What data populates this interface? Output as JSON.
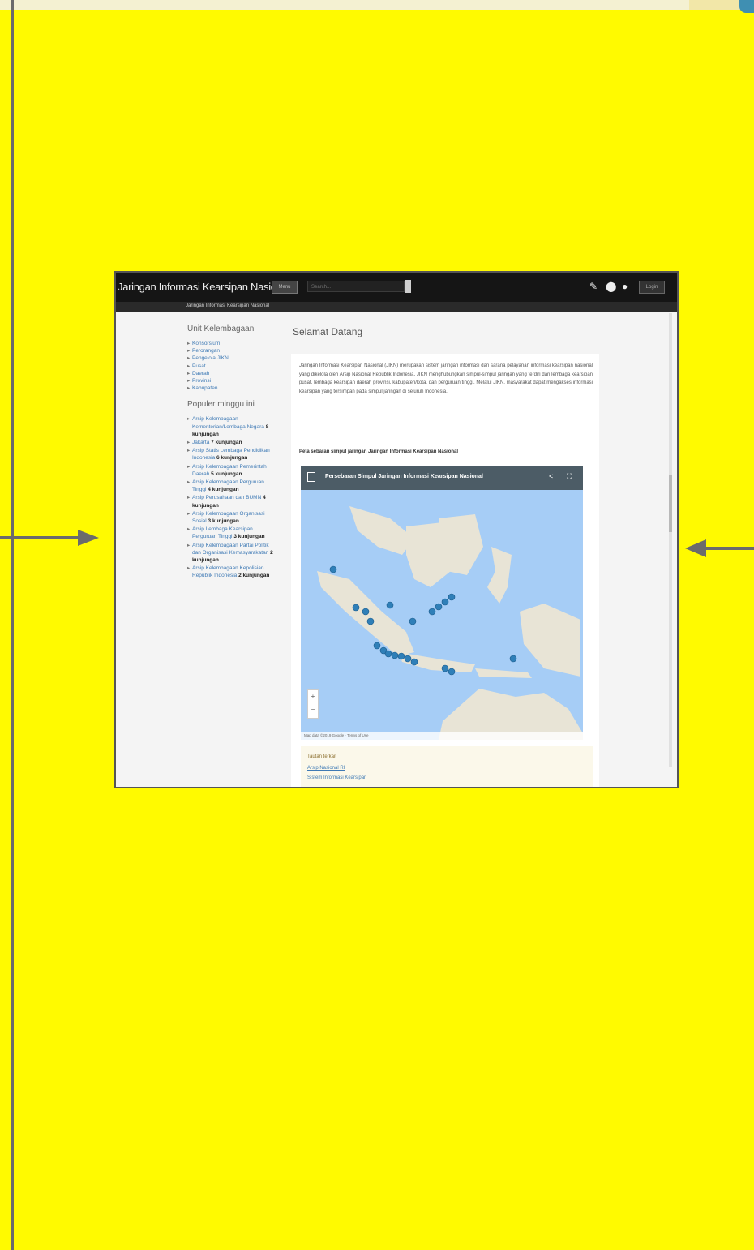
{
  "app": {
    "title": "Jaringan Informasi Kearsipan Nasional",
    "nav_button": "Menu",
    "search_placeholder": "Search...",
    "login_button": "Login",
    "breadcrumb": "Jaringan Informasi Kearsipan Nasional"
  },
  "sidebar": {
    "section1_title": "Unit Kelembagaan",
    "items": [
      "Konsorsium",
      "Perorangan",
      "Pengelola JIKN",
      "Pusat",
      "Daerah",
      "Provinsi",
      "Kabupaten"
    ],
    "section2_title": "Populer minggu ini",
    "popular": [
      {
        "text": "Arsip Kelembagaan Kementerian/Lembaga Negara",
        "count": "8 kunjungan"
      },
      {
        "text": "Jakarta",
        "count": "7 kunjungan"
      },
      {
        "text": "Arsip Statis Lembaga Pendidikan Indonesia",
        "count": "6 kunjungan"
      },
      {
        "text": "Arsip Kelembagaan Pemerintah Daerah",
        "count": "5 kunjungan"
      },
      {
        "text": "Arsip Kelembagaan Perguruan Tinggi",
        "count": "4 kunjungan"
      },
      {
        "text": "Arsip Perusahaan dan BUMN",
        "count": "4 kunjungan"
      },
      {
        "text": "Arsip Kelembagaan Organisasi Sosial",
        "count": "3 kunjungan"
      },
      {
        "text": "Arsip Lembaga Kearsipan Perguruan Tinggi",
        "count": "3 kunjungan"
      },
      {
        "text": "Arsip Kelembagaan Partai Politik dan Organisasi Kemasyarakatan",
        "count": "2 kunjungan"
      },
      {
        "text": "Arsip Kelembagaan Kepolisian Republik Indonesia",
        "count": "2 kunjungan"
      }
    ]
  },
  "main": {
    "heading": "Selamat Datang",
    "intro": "Jaringan Informasi Kearsipan Nasional (JIKN) merupakan sistem jaringan informasi dan sarana pelayanan informasi kearsipan nasional yang dikelola oleh Arsip Nasional Republik Indonesia. JIKN menghubungkan simpul-simpul jaringan yang terdiri dari lembaga kearsipan pusat, lembaga kearsipan daerah provinsi, kabupaten/kota, dan perguruan tinggi. Melalui JIKN, masyarakat dapat mengakses informasi kearsipan yang tersimpan pada simpul jaringan di seluruh Indonesia.",
    "caption": "Peta sebaran simpul jaringan Jaringan Informasi Kearsipan Nasional",
    "map_title": "Persebaran Simpul Jaringan Informasi Kearsipan Nasional",
    "map_attribution": "Map data ©2019 Google · Terms of Use",
    "footer_label": "Tautan terkait",
    "footer_links": [
      "Arsip Nasional RI",
      "Sistem Informasi Kearsipan"
    ]
  }
}
